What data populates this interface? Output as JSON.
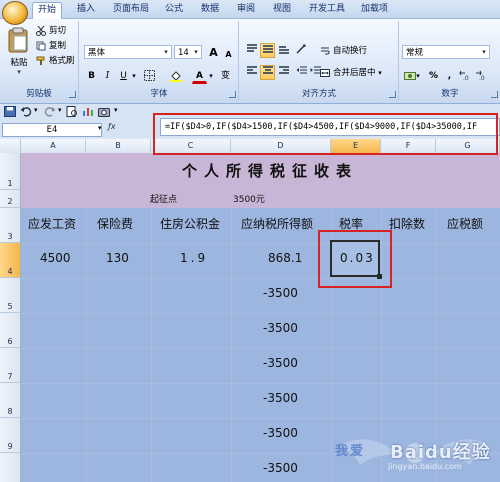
{
  "ribbon": {
    "tabs": [
      "开始",
      "插入",
      "页面布局",
      "公式",
      "数据",
      "审阅",
      "视图",
      "开发工具",
      "加载项"
    ],
    "active_tab": "开始",
    "clipboard": {
      "paste": "粘贴",
      "cut": "剪切",
      "copy": "复制",
      "format_painter": "格式刷",
      "label": "剪贴板"
    },
    "font": {
      "name": "黑体",
      "size": "14",
      "bold": "B",
      "italic": "I",
      "underline": "U",
      "font_color": "A",
      "grow": "A",
      "shrink": "A",
      "label": "字体"
    },
    "alignment": {
      "wrap_text": "自动换行",
      "merge_center": "合并后居中",
      "label": "对齐方式"
    },
    "number": {
      "format": "常规",
      "percent": "%",
      "comma": ",",
      "label": "数字"
    }
  },
  "formula_bar": {
    "name_box": "E4",
    "formula": "=IF($D4>0,IF($D4>1500,IF($D4>4500,IF($D4>9000,IF($D4>35000,IF"
  },
  "columns": [
    "A",
    "B",
    "C",
    "D",
    "E",
    "F",
    "G"
  ],
  "active_column": "E",
  "rows": [
    "1",
    "2",
    "3",
    "4",
    "5",
    "6",
    "7",
    "8",
    "9"
  ],
  "active_row": "4",
  "sheet": {
    "title": "个人所得税征收表",
    "threshold_label": "起征点",
    "threshold_value": "3500元",
    "headers": [
      "应发工资",
      "保险费",
      "住房公积金",
      "应纳税所得额",
      "税率",
      "扣除数",
      "应税额"
    ],
    "row4": {
      "salary": "4500",
      "insurance": "130",
      "housing_fund": "1.9",
      "taxable_income": "868.1",
      "tax_rate": "0.03"
    },
    "taxable_income_rest": [
      "-3500",
      "-3500",
      "-3500",
      "-3500",
      "-3500",
      "-3500"
    ]
  },
  "watermark": {
    "brand": "Baidu经验",
    "url": "jingyan.baidu.com",
    "slogan": "我爱"
  },
  "colors": {
    "ribbon_bg": "#dfe8f5",
    "sheet_fill": "#9cb6e0",
    "title_fill": "#c9b6d6",
    "highlight": "#d52222"
  }
}
